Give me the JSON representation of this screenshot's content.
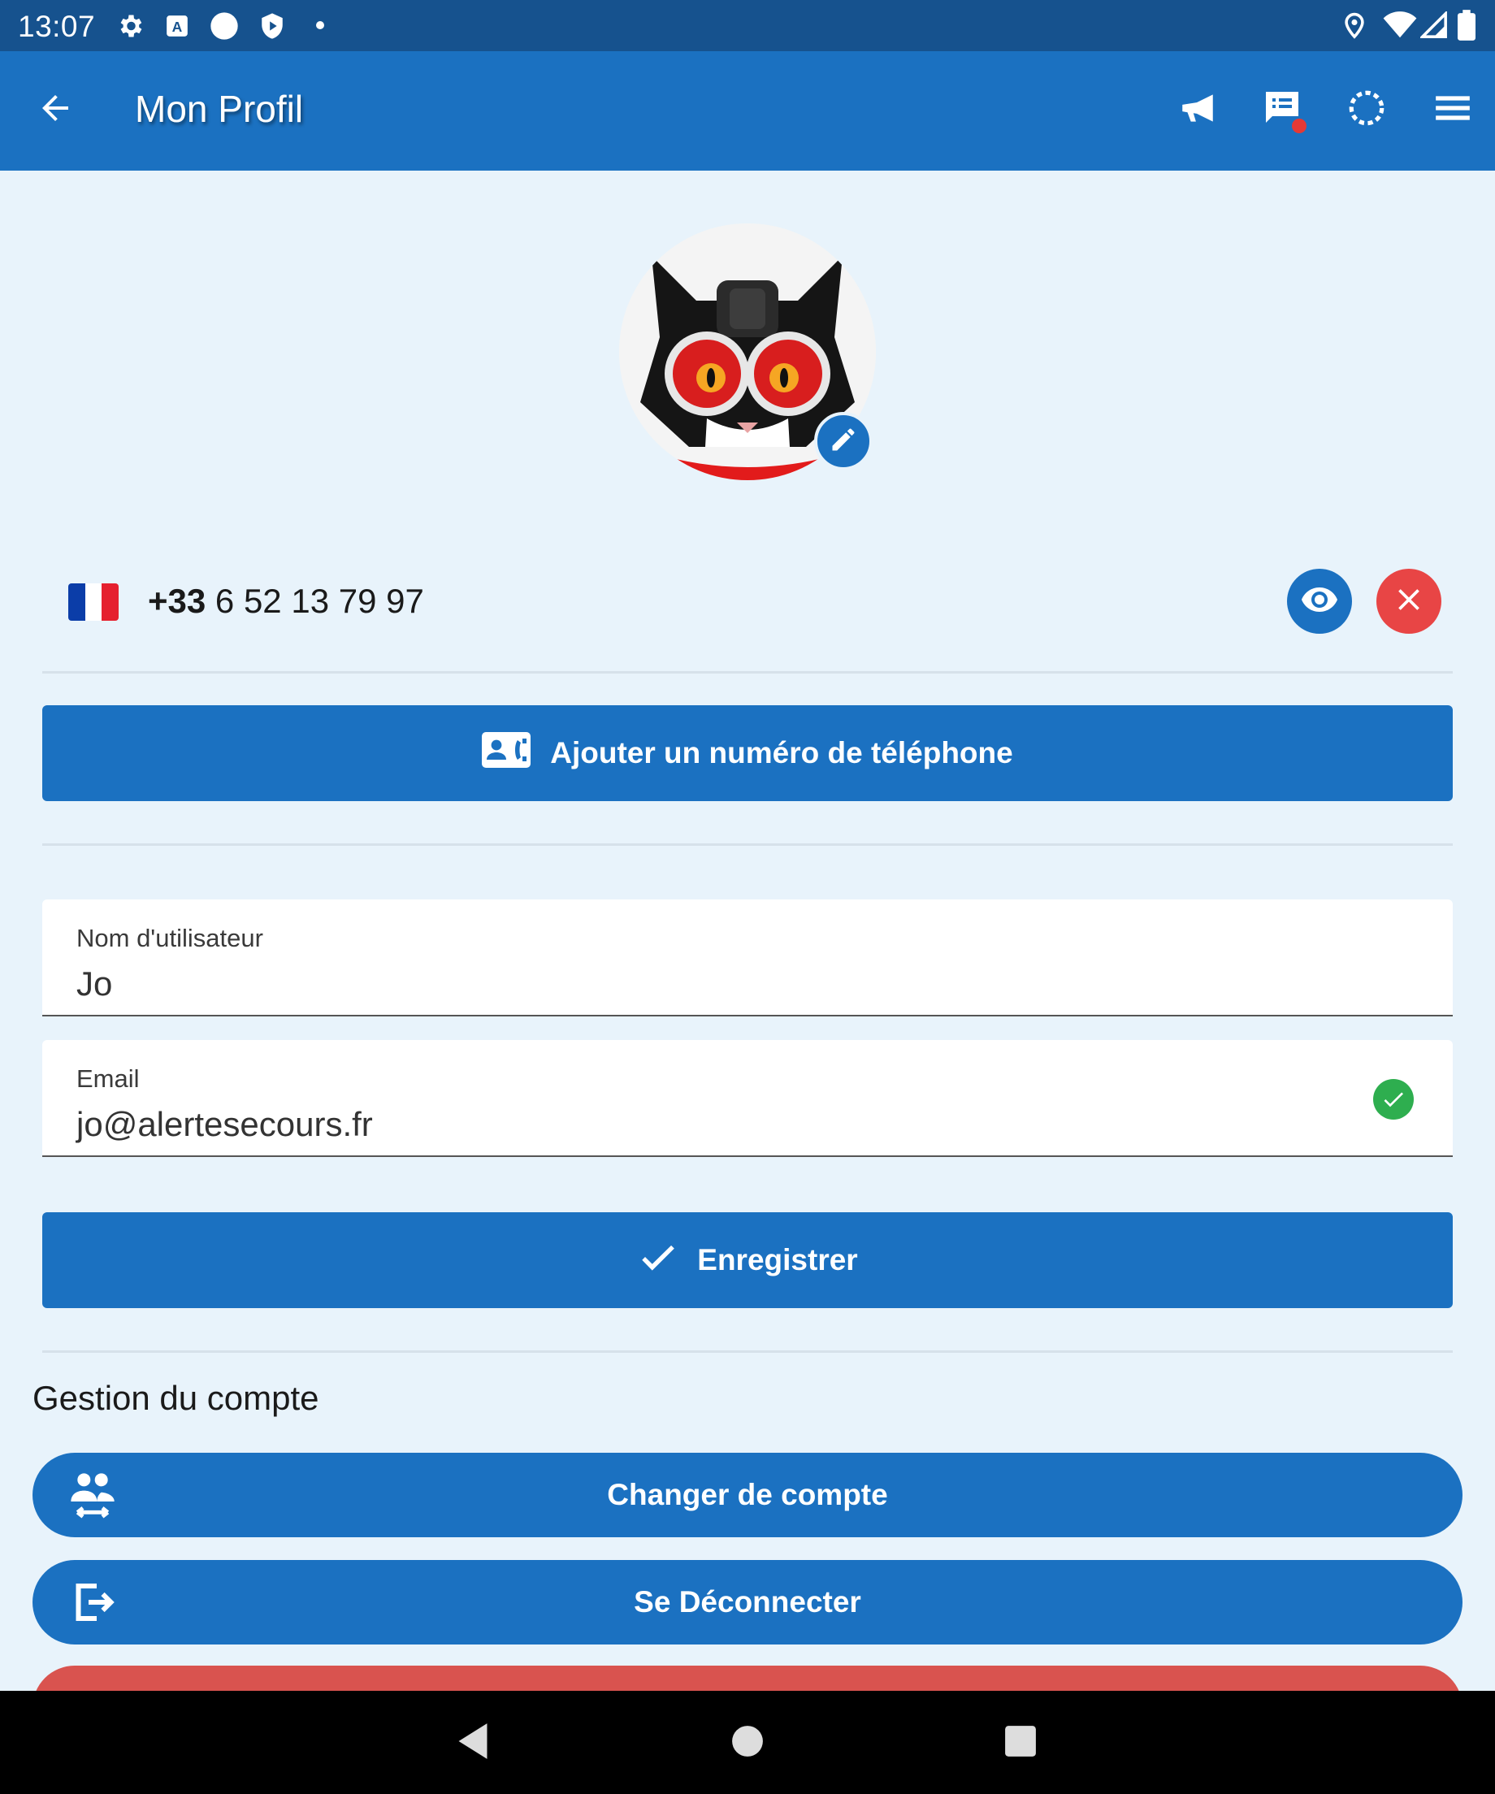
{
  "status_bar": {
    "time": "13:07",
    "left_icons": [
      "gear-icon",
      "keyboard-a-icon",
      "circle-icon",
      "shield-icon",
      "dot-icon"
    ],
    "right_icons": [
      "location-icon",
      "wifi-icon",
      "signal-icon",
      "battery-icon"
    ]
  },
  "app_bar": {
    "title": "Mon Profil",
    "back_icon": "arrow-left-icon",
    "actions": [
      "megaphone-icon",
      "message-list-icon",
      "refresh-icon",
      "menu-icon"
    ],
    "notification_dot_color": "#e53935"
  },
  "profile": {
    "avatar_alt": "profile avatar cat with goggles",
    "edit_icon": "pencil-icon"
  },
  "phone": {
    "country_code": "+33",
    "number": " 6 52 13 79 97",
    "flag": "france-flag-icon",
    "view_icon": "eye-icon",
    "delete_icon": "close-icon"
  },
  "add_phone_button": {
    "label": "Ajouter un numéro de téléphone",
    "icon": "contact-phone-icon"
  },
  "fields": {
    "username": {
      "label": "Nom d'utilisateur",
      "value": "Jo"
    },
    "email": {
      "label": "Email",
      "value": "jo@alertesecours.fr",
      "status_icon": "check-circle-icon"
    }
  },
  "save_button": {
    "label": "Enregistrer",
    "icon": "check-icon"
  },
  "account": {
    "title": "Gestion du compte",
    "switch_label": "Changer de compte",
    "switch_icon": "switch-account-icon",
    "logout_label": "Se Déconnecter",
    "logout_icon": "logout-icon"
  },
  "nav_bar": {
    "buttons": [
      "back-triangle-icon",
      "home-circle-icon",
      "recents-square-icon"
    ]
  },
  "colors": {
    "primary": "#1b71c1",
    "status_bar": "#16528e",
    "background": "#e8f3fb",
    "danger": "#e04f4f",
    "success": "#2eae4f"
  }
}
